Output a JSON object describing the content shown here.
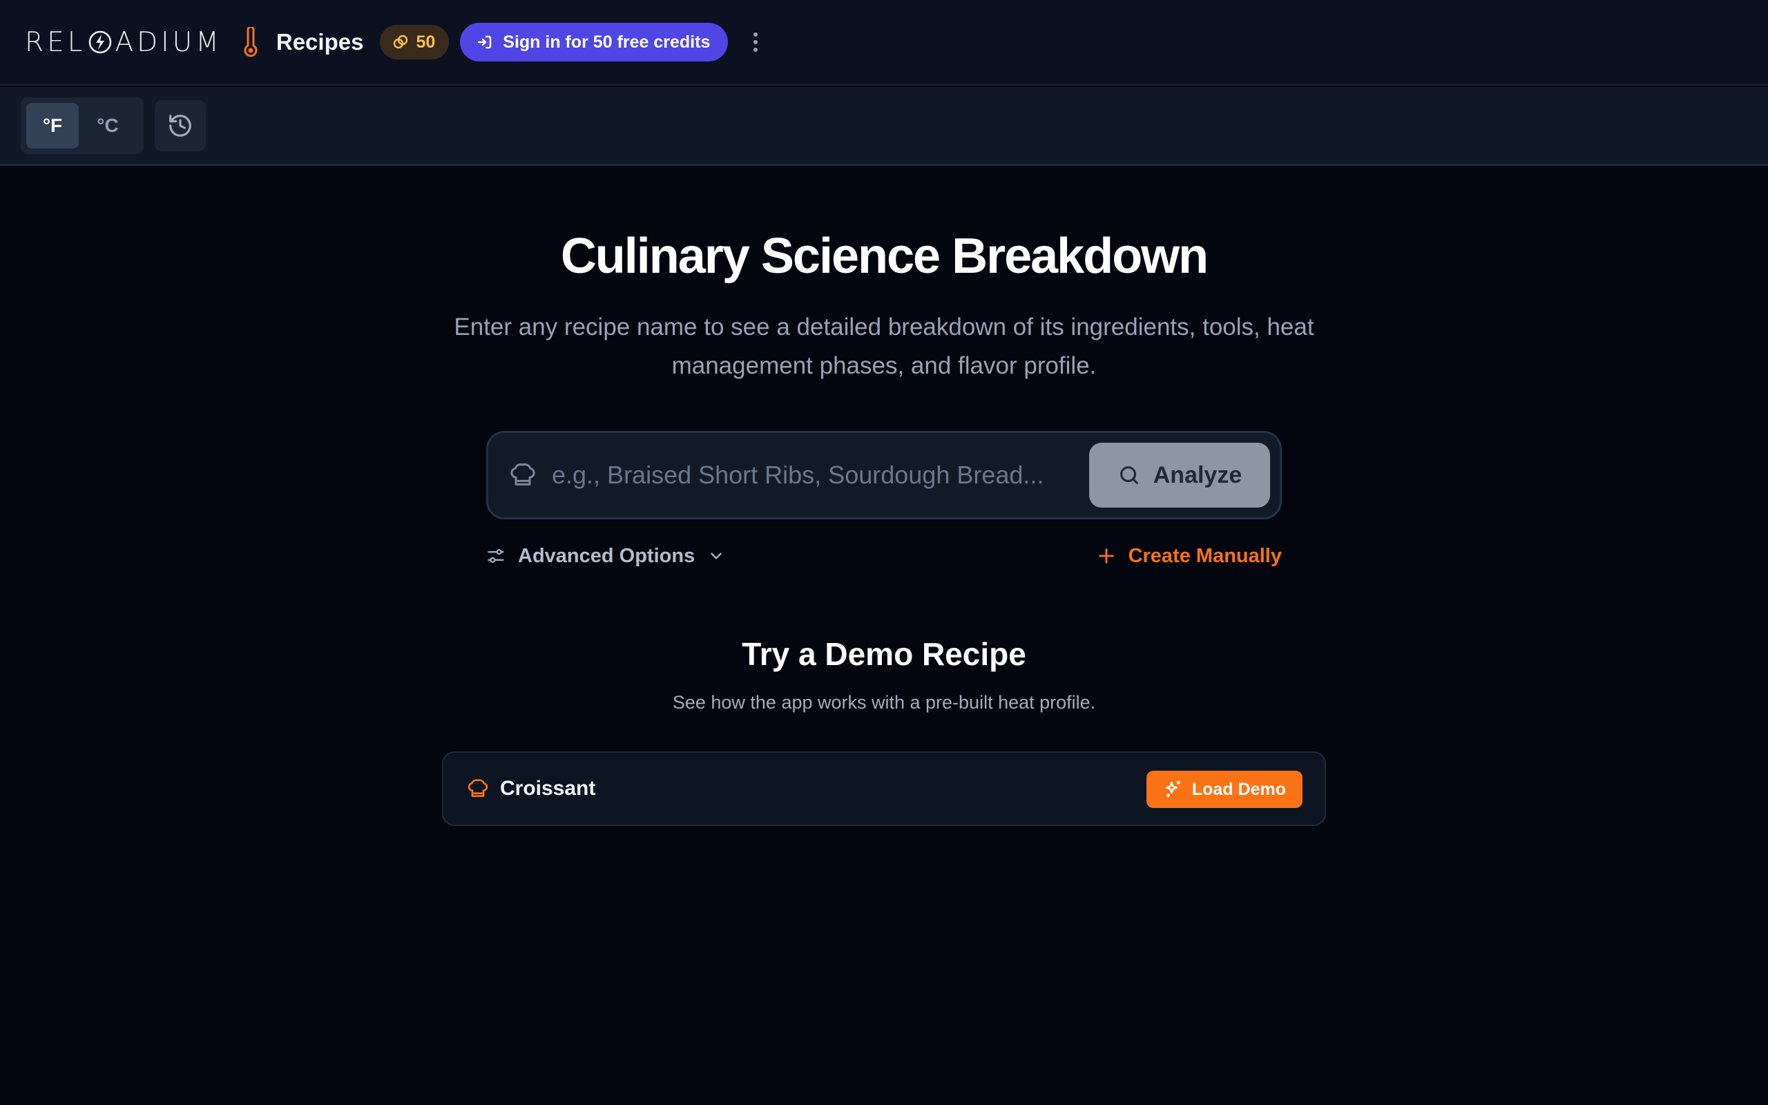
{
  "header": {
    "logo_text_pre": "REL",
    "logo_text_post": "ADIUM",
    "app_name": "Recipes",
    "credits_count": "50",
    "signin_label": "Sign in for 50 free credits"
  },
  "toolbar": {
    "unit_f": "°F",
    "unit_c": "°C",
    "active_unit": "°F"
  },
  "main": {
    "title": "Culinary Science Breakdown",
    "subtitle": "Enter any recipe name to see a detailed breakdown of its ingredients, tools, heat management phases, and flavor profile.",
    "search_placeholder": "e.g., Braised Short Ribs, Sourdough Bread...",
    "search_value": "",
    "analyze_label": "Analyze",
    "advanced_options_label": "Advanced Options",
    "create_manually_label": "Create Manually"
  },
  "demo": {
    "title": "Try a Demo Recipe",
    "subtitle": "See how the app works with a pre-built heat profile.",
    "recipe_name": "Croissant",
    "load_label": "Load Demo"
  },
  "colors": {
    "accent_orange": "#f97316",
    "signin_indigo": "#4f46e5",
    "credits_gold": "#f6c343",
    "background": "#03060f"
  },
  "icons": [
    "thermometer-icon",
    "coin-icon",
    "sign-in-icon",
    "more-vertical-icon",
    "history-icon",
    "chef-hat-icon",
    "search-icon",
    "sliders-icon",
    "chevron-down-icon",
    "plus-icon",
    "sparkles-icon"
  ]
}
